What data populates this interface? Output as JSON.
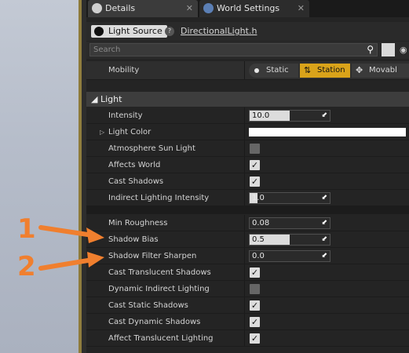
{
  "tabs": [
    {
      "label": "Details",
      "close": "✕"
    },
    {
      "label": "World Settings",
      "close": "✕"
    }
  ],
  "source": {
    "button_label": "Light Source",
    "link_label": "DirectionalLight.h"
  },
  "search": {
    "placeholder": "Search"
  },
  "mobility": {
    "label": "Mobility",
    "options": [
      "Static",
      "Station",
      "Movabl"
    ],
    "selected": "Station"
  },
  "section": {
    "title": "Light"
  },
  "properties": [
    {
      "label": "Intensity",
      "type": "slider",
      "value": "10.0",
      "fill": 0.5
    },
    {
      "label": "Light Color",
      "type": "color",
      "color": "#ffffff"
    },
    {
      "label": "Atmosphere Sun Light",
      "type": "checkbox",
      "checked": false
    },
    {
      "label": "Affects World",
      "type": "checkbox",
      "checked": true
    },
    {
      "label": "Cast Shadows",
      "type": "checkbox",
      "checked": true
    },
    {
      "label": "Indirect Lighting Intensity",
      "type": "slider",
      "value": "1.0",
      "fill": 0.1
    },
    {
      "label": "Min Roughness",
      "type": "number",
      "value": "0.08"
    },
    {
      "label": "Shadow Bias",
      "type": "slider",
      "value": "0.5",
      "fill": 0.5
    },
    {
      "label": "Shadow Filter Sharpen",
      "type": "number",
      "value": "0.0"
    },
    {
      "label": "Cast Translucent Shadows",
      "type": "checkbox",
      "checked": true
    },
    {
      "label": "Dynamic Indirect Lighting",
      "type": "checkbox",
      "checked": false
    },
    {
      "label": "Cast Static Shadows",
      "type": "checkbox",
      "checked": true
    },
    {
      "label": "Cast Dynamic Shadows",
      "type": "checkbox",
      "checked": true
    },
    {
      "label": "Affect Translucent Lighting",
      "type": "checkbox",
      "checked": true
    }
  ],
  "annotations": [
    "1",
    "2"
  ],
  "colors": {
    "accent": "#d9a31a",
    "annotation": "#f07f2e"
  }
}
